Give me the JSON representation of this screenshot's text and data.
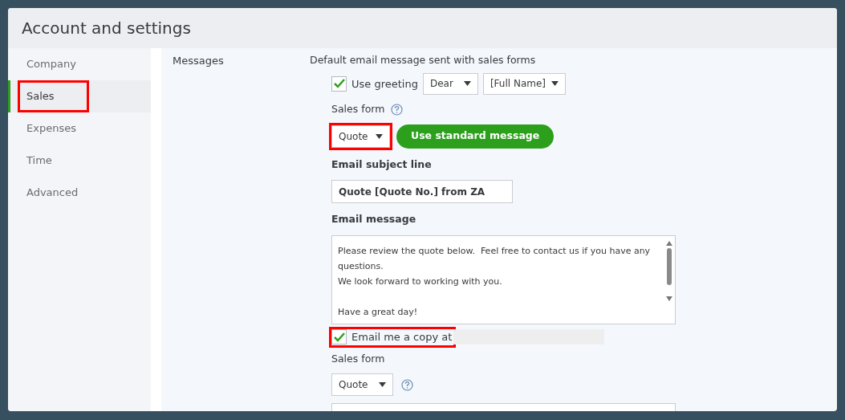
{
  "window": {
    "title": "Account and settings"
  },
  "sidebar": {
    "items": [
      {
        "label": "Company",
        "selected": false,
        "highlighted": false
      },
      {
        "label": "Sales",
        "selected": true,
        "highlighted": true
      },
      {
        "label": "Expenses",
        "selected": false,
        "highlighted": false
      },
      {
        "label": "Time",
        "selected": false,
        "highlighted": false
      },
      {
        "label": "Advanced",
        "selected": false,
        "highlighted": false
      }
    ]
  },
  "section": {
    "label": "Messages",
    "heading": "Default email message sent with sales forms",
    "greeting": {
      "checked": true,
      "label": "Use greeting",
      "salutation": "Dear",
      "name": "[Full Name]"
    },
    "sales_form": {
      "label": "Sales form",
      "value": "Quote",
      "highlighted": true,
      "button": "Use standard message"
    },
    "subject": {
      "label": "Email subject line",
      "value": "Quote [Quote No.] from ZA"
    },
    "message": {
      "label": "Email message",
      "paragraphs": [
        [
          "Please review the quote below.  Feel free to contact us if you have any questions.",
          "We look forward to working with you."
        ],
        [
          "Have a great day!"
        ]
      ]
    },
    "copy": {
      "checked": true,
      "label": "Email me a copy at",
      "highlighted": true
    },
    "sales_form_2": {
      "label": "Sales form",
      "value": "Quote"
    }
  }
}
